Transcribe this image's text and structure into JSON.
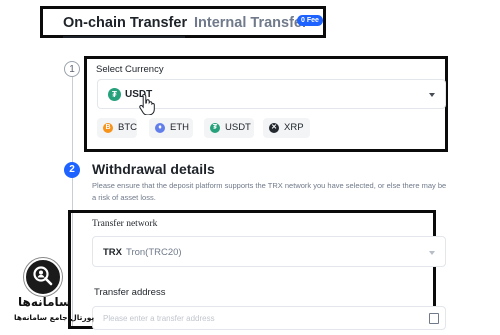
{
  "tabs": {
    "onchain": "On-chain Transfer",
    "internal": "Internal Transfer",
    "fee_badge": "0 Fee"
  },
  "steps": {
    "one": "1",
    "two": "2"
  },
  "currency": {
    "label": "Select Currency",
    "selected": "USDT",
    "selected_icon": "tether-icon",
    "quick": [
      {
        "label": "BTC",
        "icon": "bitcoin-icon",
        "color": "#f7931a"
      },
      {
        "label": "ETH",
        "icon": "ethereum-icon",
        "color": "#627eea"
      },
      {
        "label": "USDT",
        "icon": "tether-icon",
        "color": "#26a17b"
      },
      {
        "label": "XRP",
        "icon": "xrp-icon",
        "color": "#23292f"
      }
    ]
  },
  "withdrawal": {
    "title": "Withdrawal details",
    "notice": "Please ensure that the deposit platform supports the TRX network you have selected, or else there may be a risk of asset loss.",
    "network_label": "Transfer network",
    "network_code": "TRX",
    "network_name": "Tron(TRC20)",
    "address_label": "Transfer address",
    "address_placeholder": "Please enter a transfer address"
  },
  "watermark": {
    "title": "سامانه‌ها",
    "subtitle": "پورتال جامع سامانه‌ها"
  },
  "colors": {
    "accent": "#1e62ff",
    "tether": "#26a17b",
    "frame": "#0b0b0b"
  }
}
